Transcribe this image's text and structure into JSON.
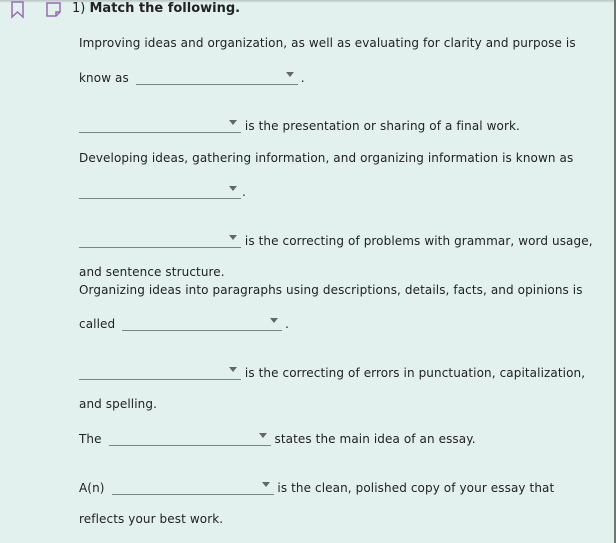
{
  "question": {
    "number": "1)",
    "title": "Match the following."
  },
  "colors": {
    "background": "#e2f1ee",
    "icon_accent": "#9b6bb5"
  },
  "items": [
    {
      "before": "Improving ideas and organization, as well as evaluating for clarity and purpose is",
      "prefix": "know as",
      "selected": "",
      "after": "."
    },
    {
      "prefix": "",
      "selected": "",
      "after": "is the presentation or sharing of a final work."
    },
    {
      "before": "Developing ideas, gathering information, and organizing information is known as",
      "prefix": "",
      "selected": "",
      "after": "."
    },
    {
      "prefix": "",
      "selected": "",
      "after": "is the correcting of problems with grammar, word usage,",
      "continuation": "and sentence structure."
    },
    {
      "before": "Organizing ideas into paragraphs using descriptions, details, facts, and opinions is",
      "prefix": "called",
      "selected": "",
      "after": "."
    },
    {
      "prefix": "",
      "selected": "",
      "after": "is the correcting of errors in punctuation, capitalization,",
      "continuation": "and spelling."
    },
    {
      "prefix": "The",
      "selected": "",
      "after": "states the main idea of an essay."
    },
    {
      "prefix": "A(n)",
      "selected": "",
      "after": "is the clean, polished copy of your essay that",
      "continuation": "reflects your best work."
    }
  ]
}
